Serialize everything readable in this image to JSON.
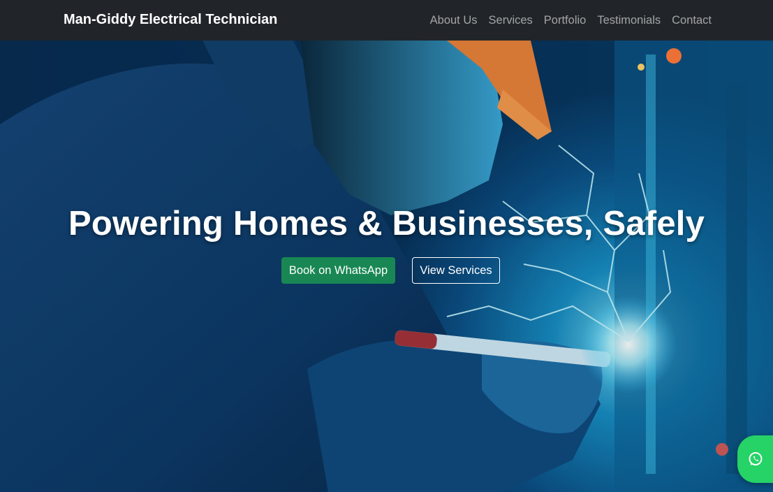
{
  "navbar": {
    "brand": "Man-Giddy Electrical Technician",
    "links": [
      "About Us",
      "Services",
      "Portfolio",
      "Testimonials",
      "Contact"
    ]
  },
  "hero": {
    "title": "Powering Homes & Businesses, Safely",
    "primary_button": "Book on WhatsApp",
    "secondary_button": "View Services"
  },
  "floating_button": {
    "icon": "whatsapp-icon"
  },
  "colors": {
    "navbar_bg": "#212529",
    "primary": "#198754",
    "whatsapp": "#25d366",
    "nav_link": "rgba(255,255,255,0.55)"
  }
}
